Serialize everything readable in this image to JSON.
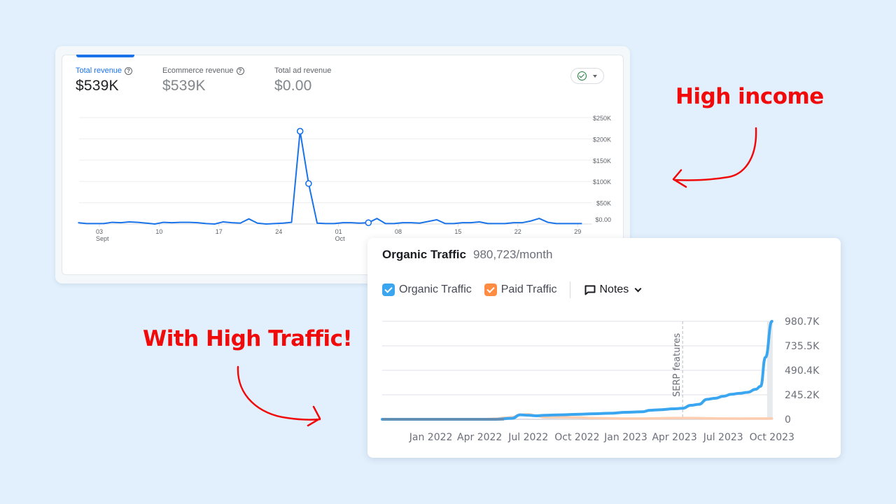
{
  "revenue_card": {
    "metrics": [
      {
        "label": "Total revenue",
        "value": "$539K",
        "help_icon": "question-circle-icon",
        "active": true
      },
      {
        "label": "Ecommerce revenue",
        "value": "$539K",
        "help_icon": "question-circle-icon",
        "active": false
      },
      {
        "label": "Total ad revenue",
        "value": "$0.00",
        "active": false
      }
    ],
    "status_button": {
      "icon": "check-circle-icon",
      "caret": "caret-down-icon"
    },
    "colors": {
      "line": "#1a73e8",
      "status_ok": "#188038"
    }
  },
  "traffic_card": {
    "title": "Organic Traffic",
    "count": "980,723/month",
    "legend": [
      {
        "label": "Organic Traffic",
        "checked": true,
        "color": "#3ba6f0"
      },
      {
        "label": "Paid Traffic",
        "checked": true,
        "color": "#ff8c42"
      }
    ],
    "notes_label": "Notes",
    "notes_icon": "comment-icon",
    "notes_caret": "chevron-down-icon",
    "marker_label": "SERP features"
  },
  "annotations": {
    "income": "High income",
    "traffic": "With High Traffic!",
    "color": "#f00a0a"
  },
  "chart_data": [
    {
      "type": "line",
      "title": "Total revenue",
      "xlabel": "",
      "ylabel": "",
      "x_ticks": [
        {
          "day": 3,
          "label": "03",
          "sub": "Sept"
        },
        {
          "day": 10,
          "label": "10"
        },
        {
          "day": 17,
          "label": "17"
        },
        {
          "day": 24,
          "label": "24"
        },
        {
          "day": 31,
          "label": "01",
          "sub": "Oct"
        },
        {
          "day": 38,
          "label": "08"
        },
        {
          "day": 45,
          "label": "15"
        },
        {
          "day": 52,
          "label": "22"
        },
        {
          "day": 59,
          "label": "29"
        }
      ],
      "y_ticks": [
        "$0.00",
        "$50K",
        "$100K",
        "$150K",
        "$200K",
        "$250K"
      ],
      "ylim": [
        0,
        250
      ],
      "y_unit": "$K",
      "x_start_day": 0.5,
      "series": [
        {
          "name": "Total revenue",
          "values": [
            3,
            1,
            1,
            1,
            4,
            3,
            5,
            4,
            2,
            0,
            4,
            3,
            4,
            4,
            3,
            1,
            0,
            5,
            3,
            2,
            12,
            2,
            0,
            1,
            2,
            4,
            218,
            95,
            2,
            1,
            1,
            3,
            3,
            2,
            3,
            13,
            1,
            1,
            3,
            3,
            2,
            6,
            10,
            1,
            1,
            3,
            3,
            5,
            1,
            1,
            1,
            3,
            3,
            7,
            13,
            4,
            1,
            1,
            1,
            1
          ],
          "highlighted_points": [
            26,
            27,
            34
          ]
        }
      ],
      "grid": true
    },
    {
      "type": "line",
      "title": "Organic Traffic",
      "y_ticks": [
        "0",
        "245.2K",
        "490.4K",
        "735.5K",
        "980.7K"
      ],
      "ylim": [
        0,
        980.7
      ],
      "y_unit": "K",
      "x_ticks": [
        "Jan 2022",
        "Apr 2022",
        "Jul 2022",
        "Oct 2022",
        "Jan 2023",
        "Apr 2023",
        "Jul 2023",
        "Oct 2023"
      ],
      "x_range_months": [
        "Oct 2021",
        "Oct 2023"
      ],
      "annotation": {
        "label": "SERP features",
        "month_index": 18.5
      },
      "series": [
        {
          "name": "Organic Traffic",
          "color": "#3ba6f0",
          "months": [
            0,
            1,
            2,
            3,
            4,
            5,
            6,
            7,
            8,
            8.5,
            9,
            9.5,
            10,
            11,
            12,
            13,
            14,
            15,
            16,
            16.5,
            17,
            18,
            18.5,
            19,
            19.5,
            20,
            20.5,
            21,
            21.5,
            22,
            22.5,
            23,
            23.3,
            23.6,
            24
          ],
          "values": [
            0,
            0,
            0,
            0,
            0,
            0,
            0,
            0,
            10,
            45,
            40,
            35,
            40,
            45,
            50,
            55,
            60,
            70,
            75,
            90,
            95,
            105,
            110,
            140,
            150,
            200,
            210,
            230,
            250,
            260,
            270,
            300,
            330,
            620,
            980.7
          ]
        },
        {
          "name": "Paid Traffic",
          "color": "#ffc9a8",
          "months": [
            0,
            6,
            7,
            7.5,
            8,
            8.5,
            9,
            9.5,
            10,
            11,
            12,
            13,
            14,
            15,
            16,
            17,
            18,
            19,
            20,
            21,
            22,
            23,
            24
          ],
          "values": [
            0,
            0,
            5,
            15,
            20,
            45,
            50,
            35,
            20,
            20,
            18,
            12,
            10,
            8,
            8,
            10,
            12,
            12,
            10,
            8,
            7,
            8,
            8
          ]
        }
      ],
      "grid": true
    }
  ]
}
